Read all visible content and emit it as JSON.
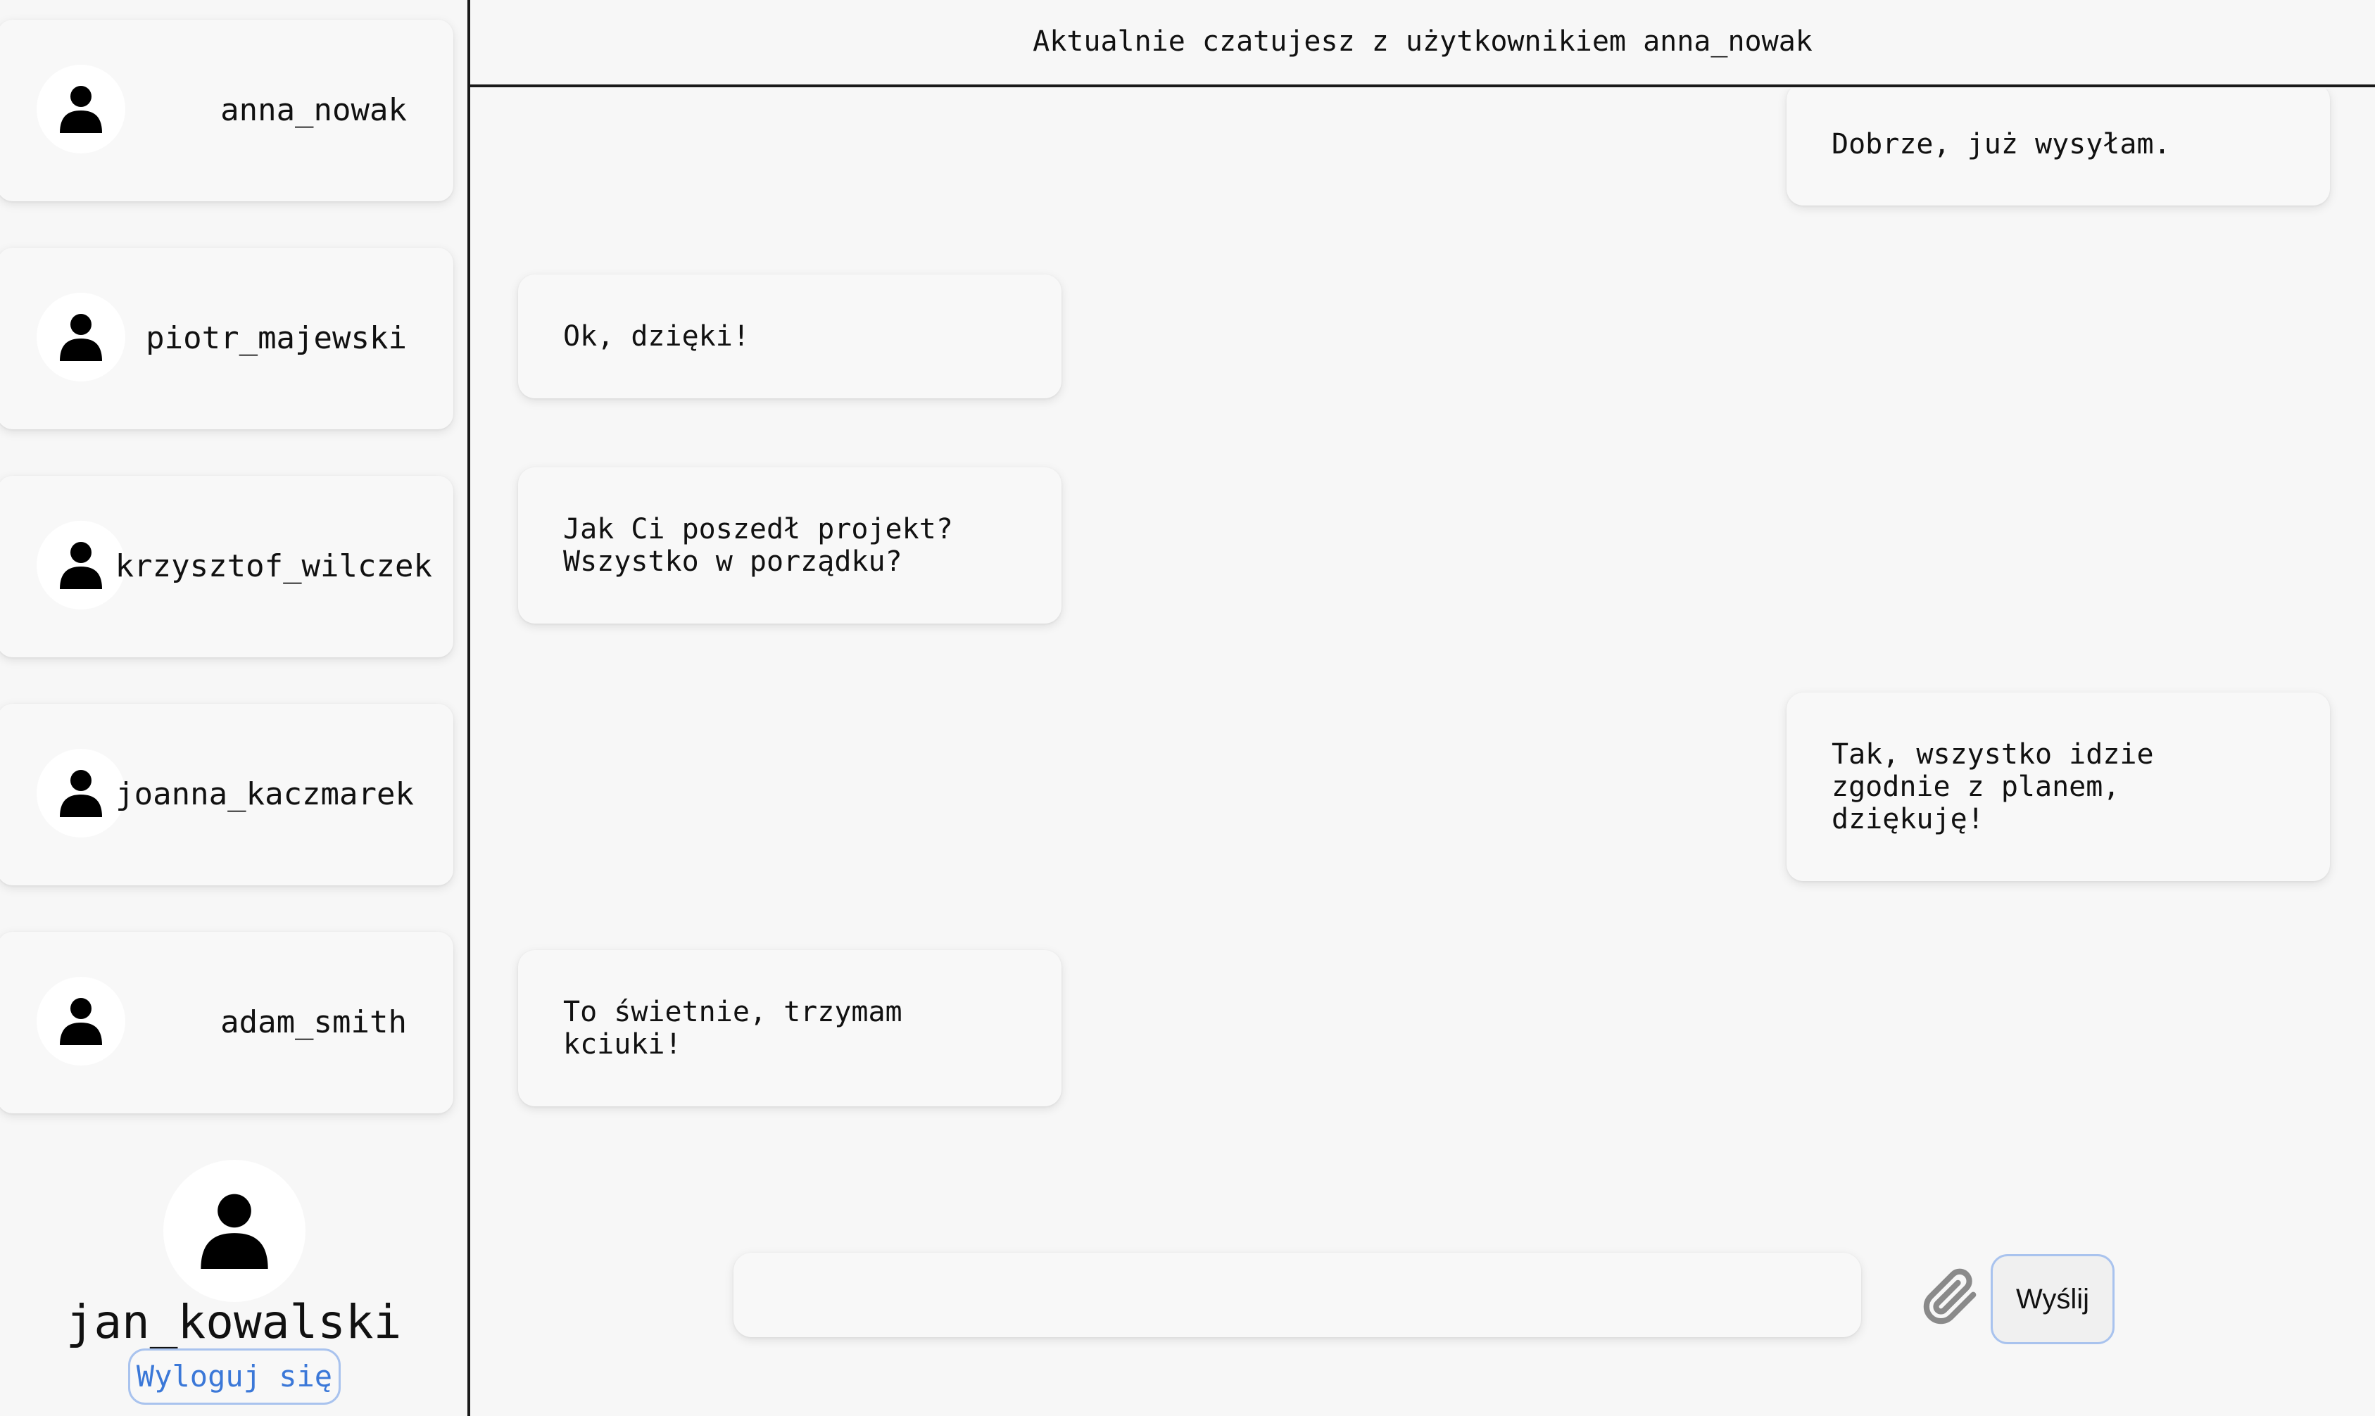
{
  "sidebar": {
    "contacts": [
      {
        "name": "anna_nowak",
        "icon": "user-icon"
      },
      {
        "name": "piotr_majewski",
        "icon": "user-icon"
      },
      {
        "name": "krzysztof_wilczek",
        "icon": "user-icon"
      },
      {
        "name": "joanna_kaczmarek",
        "icon": "user-icon"
      },
      {
        "name": "adam_smith",
        "icon": "user-icon"
      }
    ],
    "current_user": {
      "username": "jan_kowalski",
      "logout_label": "Wyloguj się"
    }
  },
  "chat": {
    "header": "Aktualnie czatujesz z użytkownikiem anna_nowak",
    "messages": [
      {
        "direction": "outgoing",
        "text": "Dobrze, już wysyłam."
      },
      {
        "direction": "incoming",
        "text": "Ok, dzięki!"
      },
      {
        "direction": "incoming",
        "text": "Jak Ci poszedł projekt?\nWszystko w porządku?"
      },
      {
        "direction": "outgoing",
        "text": "Tak, wszystko idzie\nzgodnie z planem,\ndziękuję!"
      },
      {
        "direction": "incoming",
        "text": "To świetnie, trzymam\nkciuki!"
      }
    ],
    "composer": {
      "input_value": "",
      "placeholder": "",
      "attach_icon": "paperclip-icon",
      "send_label": "Wyślij"
    }
  },
  "colors": {
    "background": "#f7f7f7",
    "card": "#f8f8f8",
    "divider": "#1a1a1a",
    "accent_border": "#a9c3ee",
    "logout_text": "#3b78d8",
    "attach_icon": "#8a8a8a"
  }
}
